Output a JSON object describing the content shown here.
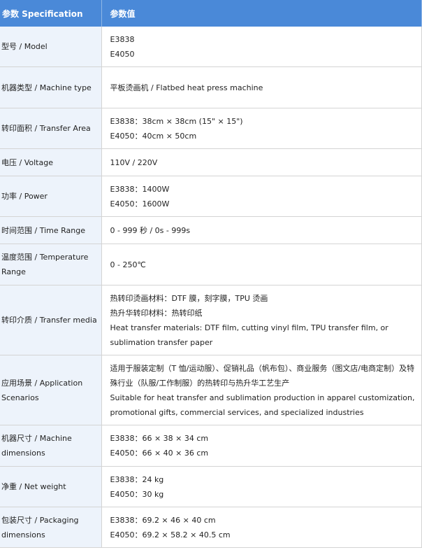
{
  "header": {
    "param": "参数 Specification",
    "value": "参数值"
  },
  "rows": [
    {
      "key": "型号 / Model",
      "lines": [
        "E3838",
        "E4050"
      ]
    },
    {
      "key": "机器类型 / Machine type",
      "lines": [
        "平板烫画机 / Flatbed heat press machine"
      ]
    },
    {
      "key": "转印面积 / Transfer Area",
      "lines": [
        "E3838：38cm × 38cm (15\" × 15\")",
        "E4050：40cm × 50cm"
      ]
    },
    {
      "key": "电压 / Voltage",
      "lines": [
        "110V / 220V"
      ]
    },
    {
      "key": "功率 / Power",
      "lines": [
        "E3838：1400W",
        "E4050：1600W"
      ]
    },
    {
      "key": "时间范围 / Time Range",
      "lines": [
        "0 - 999 秒 / 0s - 999s"
      ]
    },
    {
      "key": "温度范围 / Temperature Range",
      "lines": [
        "0 - 250℃"
      ]
    },
    {
      "key": "转印介质 / Transfer media",
      "lines": [
        "热转印烫画材料：DTF 膜，刻字膜，TPU 烫画",
        "热升华转印材料：热转印纸",
        "Heat transfer materials: DTF film, cutting vinyl film, TPU transfer film, or sublimation transfer paper"
      ]
    },
    {
      "key": "应用场景 / Application Scenarios",
      "lines": [
        "适用于服装定制（T 恤/运动服）、促销礼品（帆布包）、商业服务（图文店/电商定制）及特殊行业（队服/工作制服）的热转印与热升华工艺生产",
        "Suitable for heat transfer and sublimation production in apparel customization, promotional gifts, commercial services, and specialized industries"
      ]
    },
    {
      "key": "机器尺寸 / Machine dimensions",
      "lines": [
        "E3838：66 × 38 × 34 cm",
        "E4050：66 × 40 × 36 cm"
      ]
    },
    {
      "key": "净重 / Net weight",
      "lines": [
        "E3838：24 kg",
        "E4050：30 kg"
      ]
    },
    {
      "key": "包装尺寸 / Packaging dimensions",
      "lines": [
        "E3838：69.2 × 46 × 40 cm",
        "E4050：69.2 × 58.2 × 40.5 cm"
      ]
    }
  ]
}
